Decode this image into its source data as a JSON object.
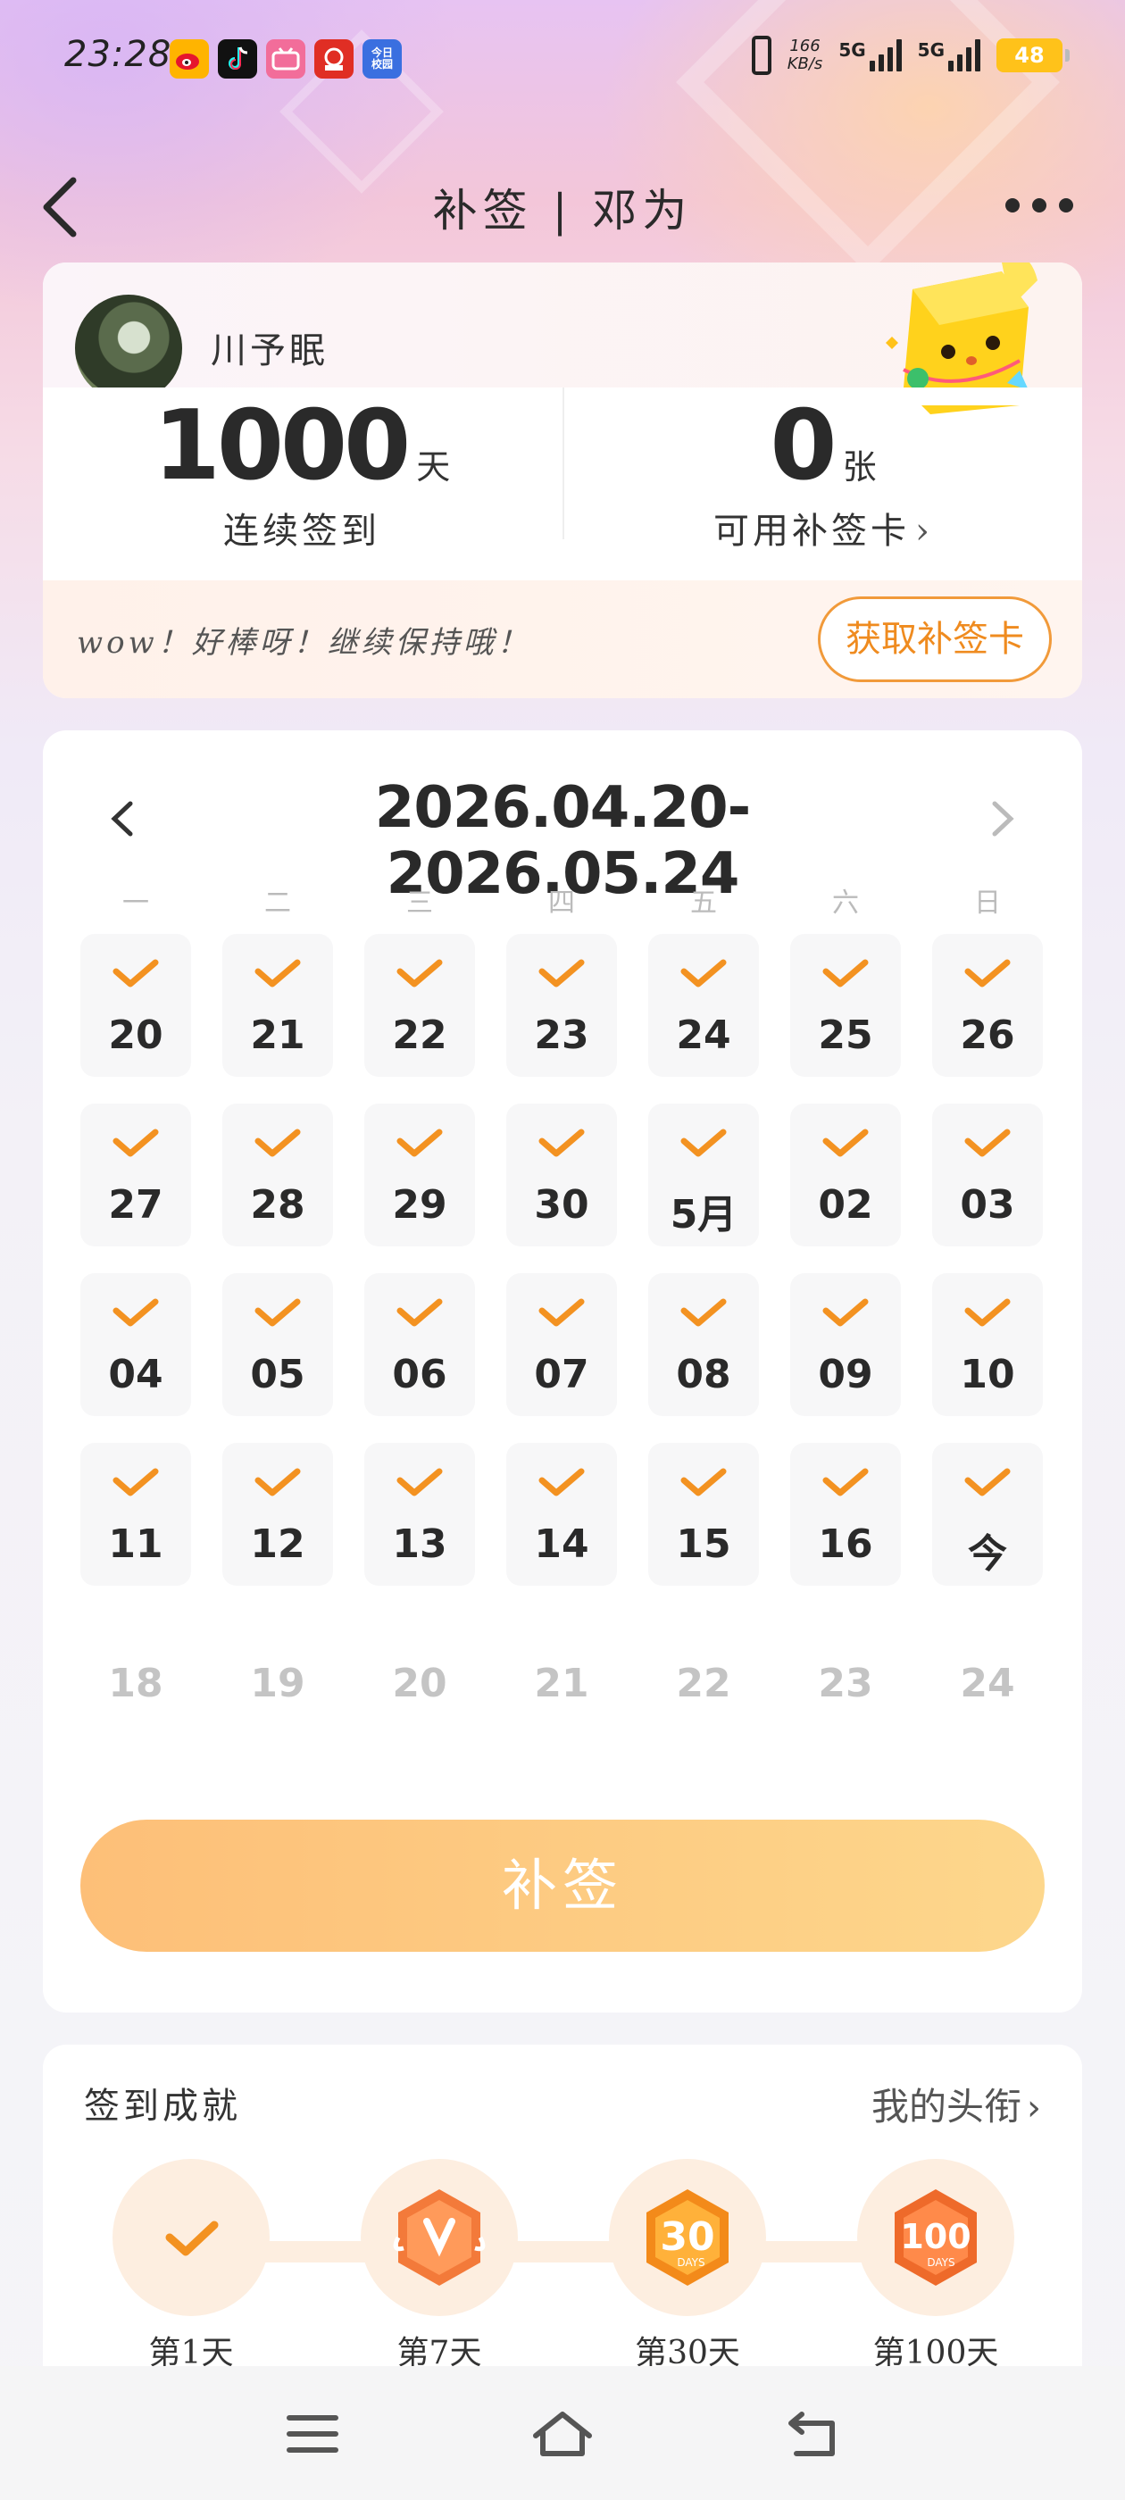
{
  "status_bar": {
    "time": "23:28",
    "net_speed_value": "166",
    "net_speed_unit": "KB/s",
    "sim1": "5G",
    "sim2": "5G",
    "battery": "48",
    "app_icons": [
      "weibo-icon",
      "tiktok-icon",
      "bilibili-icon",
      "pinduoduo-icon",
      "jinri-xiaoyuan-icon"
    ],
    "app_icon_texts": [
      "",
      "",
      "",
      "",
      "今日\n校园"
    ]
  },
  "header": {
    "title": "补签 | 邓为"
  },
  "user": {
    "name": "川予眠",
    "streak_days": "1000",
    "streak_unit": "天",
    "streak_label": "连续签到",
    "cards_count": "0",
    "cards_unit": "张",
    "cards_label": "可用补签卡",
    "encourage": "wow！好棒呀！继续保持哦！",
    "get_card_button": "获取补签卡"
  },
  "calendar": {
    "range": "2026.04.20-2026.05.24",
    "weekdays": [
      "一",
      "二",
      "三",
      "四",
      "五",
      "六",
      "日"
    ],
    "checked_days": [
      "20",
      "21",
      "22",
      "23",
      "24",
      "25",
      "26",
      "27",
      "28",
      "29",
      "30",
      "5月",
      "02",
      "03",
      "04",
      "05",
      "06",
      "07",
      "08",
      "09",
      "10",
      "11",
      "12",
      "13",
      "14",
      "15",
      "16",
      "今"
    ],
    "future_days": [
      "18",
      "19",
      "20",
      "21",
      "22",
      "23",
      "24"
    ],
    "makeup_button": "补签"
  },
  "achievements": {
    "title": "签到成就",
    "my_titles_link": "我的头衔",
    "badges": [
      {
        "label": "第1天",
        "icon": "check-badge-icon"
      },
      {
        "label": "第7天",
        "icon": "seven-days-badge-icon"
      },
      {
        "label": "第30天",
        "icon": "thirty-days-badge-icon"
      },
      {
        "label": "第100天",
        "icon": "hundred-days-badge-icon"
      }
    ]
  },
  "colors": {
    "accent": "#ef8b1f",
    "check": "#f39221",
    "makeup_button_from": "#fdbf78",
    "makeup_button_to": "#fdd78c"
  }
}
